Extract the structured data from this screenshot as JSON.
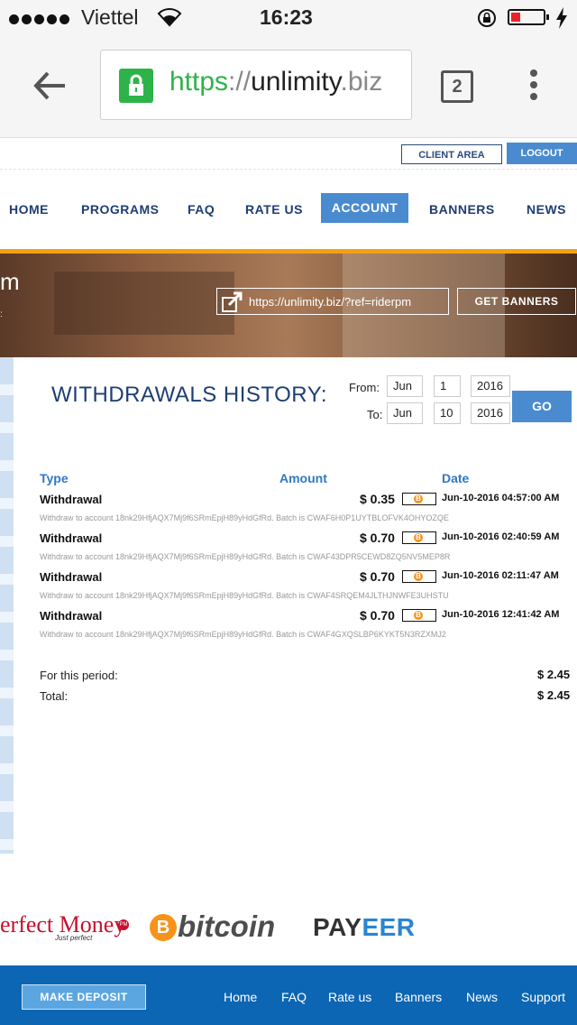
{
  "status_bar": {
    "carrier": "Viettel",
    "time": "16:23"
  },
  "browser": {
    "url_scheme": "https",
    "url_sep": "://",
    "url_host": "unlimity",
    "url_tld": ".biz",
    "tab_count": "2"
  },
  "top_buttons": {
    "client_area": "CLIENT AREA",
    "logout": "LOGOUT"
  },
  "nav": {
    "home": "HOME",
    "programs": "PROGRAMS",
    "faq": "FAQ",
    "rate_us": "RATE US",
    "account": "ACCOUNT",
    "banners": "BANNERS",
    "news": "NEWS"
  },
  "banner": {
    "partial_text": "m",
    "partial_colon": ":",
    "ref_link": "https://unlimity.biz/?ref=riderpm",
    "get_banners": "GET BANNERS"
  },
  "withdrawals": {
    "title": "WITHDRAWALS HISTORY:",
    "from_label": "From:",
    "to_label": "To:",
    "from": {
      "month": "Jun",
      "day": "1",
      "year": "2016"
    },
    "to": {
      "month": "Jun",
      "day": "10",
      "year": "2016"
    },
    "go": "GO",
    "columns": {
      "type": "Type",
      "amount": "Amount",
      "date": "Date"
    },
    "rows": [
      {
        "type": "Withdrawal",
        "amount": "$ 0.35",
        "date": "Jun-10-2016 04:57:00 AM",
        "desc": "Withdraw to account 18nk29HfjAQX7Mj9f6SRmEpjH89yHdGfRd. Batch is CWAF6H0P1UYTBLOFVK4OHYOZQE"
      },
      {
        "type": "Withdrawal",
        "amount": "$ 0.70",
        "date": "Jun-10-2016 02:40:59 AM",
        "desc": "Withdraw to account 18nk29HfjAQX7Mj9f6SRmEpjH89yHdGfRd. Batch is CWAF43DPR5CEWD8ZQ5NV5MEP8R"
      },
      {
        "type": "Withdrawal",
        "amount": "$ 0.70",
        "date": "Jun-10-2016 02:11:47 AM",
        "desc": "Withdraw to account 18nk29HfjAQX7Mj9f6SRmEpjH89yHdGfRd. Batch is CWAF4SRQEM4JLTHJNWFE3UHSTU"
      },
      {
        "type": "Withdrawal",
        "amount": "$ 0.70",
        "date": "Jun-10-2016 12:41:42 AM",
        "desc": "Withdraw to account 18nk29HfjAQX7Mj9f6SRmEpjH89yHdGfRd. Batch is CWAF4GXQSLBP6KYKT5N3RZXMJ2"
      }
    ],
    "period_label": "For this period:",
    "period_value": "$ 2.45",
    "total_label": "Total:",
    "total_value": "$ 2.45"
  },
  "payments": {
    "perfect_money": "erfect Money",
    "perfect_money_sub": "Just perfect",
    "perfect_money_badge": "PM",
    "bitcoin": "bitcoin",
    "payeer_a": "PAY",
    "payeer_b": "EER"
  },
  "footer": {
    "make_deposit": "MAKE DEPOSIT",
    "home": "Home",
    "faq": "FAQ",
    "rate_us": "Rate us",
    "banners": "Banners",
    "news": "News",
    "support": "Support"
  },
  "icons": {
    "lock": "lock-icon",
    "back": "back-arrow-icon",
    "menu": "kebab-menu-icon",
    "external": "external-link-icon",
    "coin": "bitcoin-coin-icon"
  },
  "colors": {
    "nav_blue": "#1e3e73",
    "accent_blue": "#4a8bd0",
    "orange_rule": "#f3a012",
    "footer_blue": "#0d66b3",
    "bitcoin_orange": "#f7931a"
  }
}
